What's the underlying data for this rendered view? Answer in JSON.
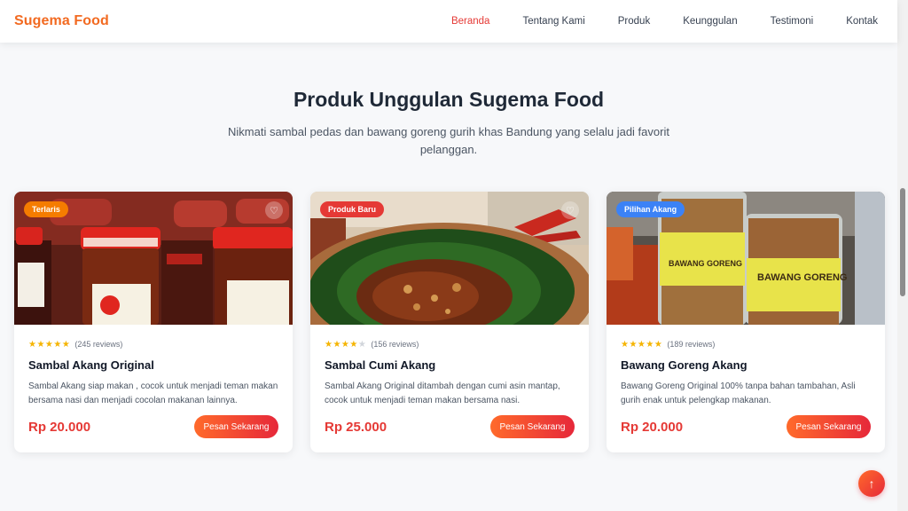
{
  "brand": "Sugema Food",
  "nav": [
    {
      "label": "Beranda",
      "active": true
    },
    {
      "label": "Tentang Kami",
      "active": false
    },
    {
      "label": "Produk",
      "active": false
    },
    {
      "label": "Keunggulan",
      "active": false
    },
    {
      "label": "Testimoni",
      "active": false
    },
    {
      "label": "Kontak",
      "active": false
    }
  ],
  "section": {
    "title": "Produk Unggulan Sugema Food",
    "subtitle": "Nikmati sambal pedas dan bawang goreng gurih khas Bandung yang selalu jadi favorit pelanggan."
  },
  "products": [
    {
      "badge": "Terlaris",
      "badge_color": "#f57c00",
      "rating": 5,
      "reviews": "(245 reviews)",
      "name": "Sambal Akang Original",
      "description": "Sambal Akang siap makan , cocok untuk menjadi teman makan bersama nasi dan menjadi cocolan makanan lainnya.",
      "price": "Rp 20.000",
      "button": "Pesan Sekarang",
      "image_icon": "chili-jar-photo"
    },
    {
      "badge": "Produk Baru",
      "badge_color": "#e53935",
      "rating": 4,
      "reviews": "(156 reviews)",
      "name": "Sambal Cumi Akang",
      "description": "Sambal Akang Original ditambah dengan cumi asin mantap, cocok untuk menjadi teman makan bersama nasi.",
      "price": "Rp 25.000",
      "button": "Pesan Sekarang",
      "image_icon": "sambal-bowl-photo"
    },
    {
      "badge": "Pilihan Akang",
      "badge_color": "#3b82f6",
      "rating": 5,
      "reviews": "(189 reviews)",
      "name": "Bawang Goreng Akang",
      "description": "Bawang Goreng Original 100% tanpa bahan tambahan, Asli gurih enak untuk pelengkap makanan.",
      "price": "Rp 20.000",
      "button": "Pesan Sekarang",
      "image_icon": "fried-shallot-jar-photo",
      "jar_labels": [
        "BAWANG GORENG",
        "BAWANG GORENG"
      ]
    }
  ],
  "colors": {
    "brand": "#f26a21",
    "accent": "#e53935",
    "star": "#f5b400"
  }
}
